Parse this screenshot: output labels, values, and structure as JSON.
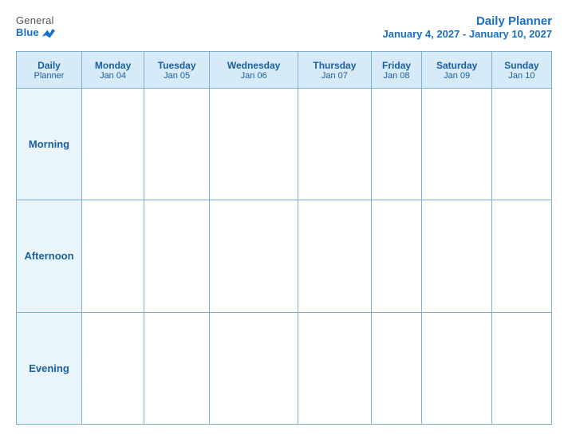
{
  "logo": {
    "general": "General",
    "blue": "Blue"
  },
  "title": {
    "main": "Daily Planner",
    "dateRange": "January 4, 2027 - January 10, 2027"
  },
  "header": {
    "labelCol": {
      "line1": "Daily",
      "line2": "Planner"
    },
    "days": [
      {
        "name": "Monday",
        "date": "Jan 04"
      },
      {
        "name": "Tuesday",
        "date": "Jan 05"
      },
      {
        "name": "Wednesday",
        "date": "Jan 06"
      },
      {
        "name": "Thursday",
        "date": "Jan 07"
      },
      {
        "name": "Friday",
        "date": "Jan 08"
      },
      {
        "name": "Saturday",
        "date": "Jan 09"
      },
      {
        "name": "Sunday",
        "date": "Jan 10"
      }
    ]
  },
  "rows": [
    {
      "label": "Morning"
    },
    {
      "label": "Afternoon"
    },
    {
      "label": "Evening"
    }
  ]
}
